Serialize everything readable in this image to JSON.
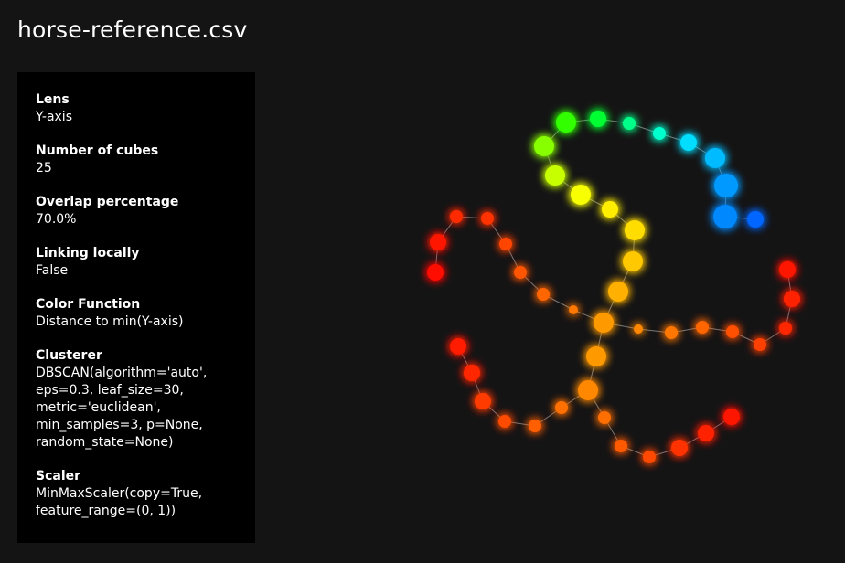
{
  "file_title": "horse-reference.csv",
  "params": [
    {
      "label": "Lens",
      "value": "Y-axis"
    },
    {
      "label": "Number of cubes",
      "value": "25"
    },
    {
      "label": "Overlap percentage",
      "value": "70.0%"
    },
    {
      "label": "Linking locally",
      "value": "False"
    },
    {
      "label": "Color Function",
      "value": "Distance to min(Y-axis)"
    },
    {
      "label": "Clusterer",
      "value": "DBSCAN(algorithm='auto',\neps=0.3, leaf_size=30,\nmetric='euclidean',\nmin_samples=3, p=None,\nrandom_state=None)"
    },
    {
      "label": "Scaler",
      "value": "MinMaxScaler(copy=True,\nfeature_range=(0, 1))"
    }
  ],
  "graph": {
    "edge_color": "#9a9a9a",
    "nodes": [
      {
        "id": 0,
        "color": "#ff1100",
        "size": 3
      },
      {
        "id": 1,
        "color": "#ff1800",
        "size": 3
      },
      {
        "id": 2,
        "color": "#ff2a00",
        "size": 2
      },
      {
        "id": 3,
        "color": "#ff3000",
        "size": 2
      },
      {
        "id": 4,
        "color": "#ff4400",
        "size": 2
      },
      {
        "id": 5,
        "color": "#ff5500",
        "size": 2
      },
      {
        "id": 6,
        "color": "#ff6600",
        "size": 2
      },
      {
        "id": 7,
        "color": "#ff7800",
        "size": 1
      },
      {
        "id": 8,
        "color": "#ff9900",
        "size": 4
      },
      {
        "id": 9,
        "color": "#ffb000",
        "size": 4
      },
      {
        "id": 10,
        "color": "#ffc800",
        "size": 4
      },
      {
        "id": 11,
        "color": "#ffdd00",
        "size": 4
      },
      {
        "id": 12,
        "color": "#ffee00",
        "size": 3
      },
      {
        "id": 13,
        "color": "#f8ff00",
        "size": 4
      },
      {
        "id": 14,
        "color": "#c8ff00",
        "size": 4
      },
      {
        "id": 15,
        "color": "#88ff00",
        "size": 4
      },
      {
        "id": 16,
        "color": "#33ff00",
        "size": 4
      },
      {
        "id": 17,
        "color": "#00ff33",
        "size": 3
      },
      {
        "id": 18,
        "color": "#00ff88",
        "size": 2
      },
      {
        "id": 19,
        "color": "#00ffcc",
        "size": 2
      },
      {
        "id": 20,
        "color": "#00ddff",
        "size": 3
      },
      {
        "id": 21,
        "color": "#00bbff",
        "size": 4
      },
      {
        "id": 22,
        "color": "#0099ff",
        "size": 5
      },
      {
        "id": 23,
        "color": "#0088ff",
        "size": 5
      },
      {
        "id": 24,
        "color": "#0066ff",
        "size": 3
      },
      {
        "id": 25,
        "color": "#ff8800",
        "size": 1
      },
      {
        "id": 26,
        "color": "#ff7700",
        "size": 2
      },
      {
        "id": 27,
        "color": "#ff6600",
        "size": 2
      },
      {
        "id": 28,
        "color": "#ff5000",
        "size": 2
      },
      {
        "id": 29,
        "color": "#ff4000",
        "size": 2
      },
      {
        "id": 30,
        "color": "#ff2800",
        "size": 2
      },
      {
        "id": 31,
        "color": "#ff2000",
        "size": 3
      },
      {
        "id": 32,
        "color": "#ff1500",
        "size": 3
      },
      {
        "id": 33,
        "color": "#ff9900",
        "size": 4
      },
      {
        "id": 34,
        "color": "#ff8800",
        "size": 4
      },
      {
        "id": 35,
        "color": "#ff6e00",
        "size": 2
      },
      {
        "id": 36,
        "color": "#ff5a00",
        "size": 2
      },
      {
        "id": 37,
        "color": "#ff4800",
        "size": 2
      },
      {
        "id": 38,
        "color": "#ff3300",
        "size": 3
      },
      {
        "id": 39,
        "color": "#ff2200",
        "size": 3
      },
      {
        "id": 40,
        "color": "#ff1200",
        "size": 3
      },
      {
        "id": 41,
        "color": "#ff7000",
        "size": 2
      },
      {
        "id": 42,
        "color": "#ff5e00",
        "size": 2
      },
      {
        "id": 43,
        "color": "#ff4c00",
        "size": 2
      },
      {
        "id": 44,
        "color": "#ff3a00",
        "size": 3
      },
      {
        "id": 45,
        "color": "#ff2800",
        "size": 3
      },
      {
        "id": 46,
        "color": "#ff1a00",
        "size": 3
      },
      {
        "id": 47,
        "color": "#ff1000",
        "size": 3
      }
    ],
    "edges": [
      [
        0,
        1
      ],
      [
        1,
        2
      ],
      [
        2,
        3
      ],
      [
        3,
        4
      ],
      [
        4,
        5
      ],
      [
        5,
        6
      ],
      [
        6,
        7
      ],
      [
        7,
        8
      ],
      [
        8,
        9
      ],
      [
        9,
        10
      ],
      [
        10,
        11
      ],
      [
        11,
        12
      ],
      [
        12,
        13
      ],
      [
        13,
        14
      ],
      [
        14,
        15
      ],
      [
        15,
        16
      ],
      [
        16,
        17
      ],
      [
        17,
        18
      ],
      [
        18,
        19
      ],
      [
        19,
        20
      ],
      [
        20,
        21
      ],
      [
        21,
        22
      ],
      [
        22,
        23
      ],
      [
        23,
        24
      ],
      [
        8,
        25
      ],
      [
        25,
        26
      ],
      [
        26,
        27
      ],
      [
        27,
        28
      ],
      [
        28,
        29
      ],
      [
        29,
        30
      ],
      [
        30,
        31
      ],
      [
        31,
        32
      ],
      [
        8,
        33
      ],
      [
        33,
        34
      ],
      [
        34,
        35
      ],
      [
        35,
        36
      ],
      [
        36,
        37
      ],
      [
        37,
        38
      ],
      [
        38,
        39
      ],
      [
        39,
        40
      ],
      [
        34,
        41
      ],
      [
        41,
        42
      ],
      [
        42,
        43
      ],
      [
        43,
        44
      ],
      [
        44,
        45
      ],
      [
        45,
        46
      ],
      [
        46,
        47
      ]
    ]
  }
}
